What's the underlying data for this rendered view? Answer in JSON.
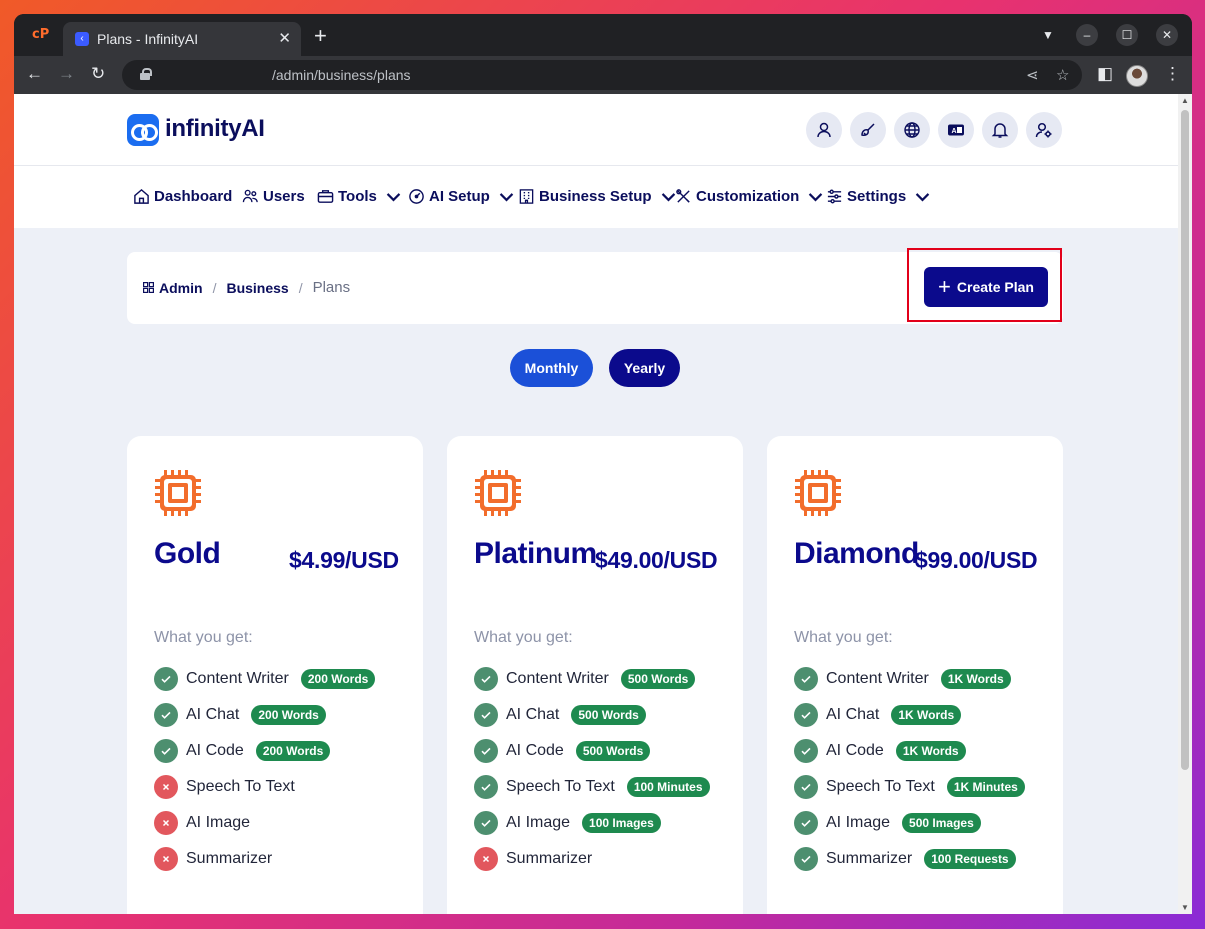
{
  "browser": {
    "tab_title": "Plans - InfinityAI",
    "url": "/admin/business/plans",
    "new_tab": "+",
    "tab_close": "✕"
  },
  "brand": {
    "name": "infinityAI"
  },
  "nav": {
    "items": [
      {
        "label": "Dashboard",
        "icon": "home-icon"
      },
      {
        "label": "Users",
        "icon": "users-icon"
      },
      {
        "label": "Tools",
        "icon": "briefcase-icon"
      },
      {
        "label": "AI Setup",
        "icon": "gauge-icon"
      },
      {
        "label": "Business Setup",
        "icon": "building-icon"
      },
      {
        "label": "Customization",
        "icon": "tools-icon"
      },
      {
        "label": "Settings",
        "icon": "sliders-icon"
      }
    ]
  },
  "breadcrumb": {
    "admin": "Admin",
    "business": "Business",
    "current": "Plans",
    "sep": "/"
  },
  "create_button": {
    "label": "Create Plan"
  },
  "billing_toggle": {
    "monthly": "Monthly",
    "yearly": "Yearly"
  },
  "colors": {
    "primary": "#0b0a8c",
    "accent": "#1b50d8",
    "success": "#1e8a4f",
    "check": "#4d8f6f",
    "cross": "#e2575d",
    "chip": "#f26d2c",
    "highlight": "#e2001a"
  },
  "plans": [
    {
      "name": "Gold",
      "price": "$4.99/USD",
      "features_heading": "What you get:",
      "features": [
        {
          "label": "Content Writer",
          "included": true,
          "badge": "200 Words"
        },
        {
          "label": "AI Chat",
          "included": true,
          "badge": "200 Words"
        },
        {
          "label": "AI Code",
          "included": true,
          "badge": "200 Words"
        },
        {
          "label": "Speech To Text",
          "included": false,
          "badge": ""
        },
        {
          "label": "AI Image",
          "included": false,
          "badge": ""
        },
        {
          "label": "Summarizer",
          "included": false,
          "badge": ""
        }
      ]
    },
    {
      "name": "Platinum",
      "price": "$49.00/USD",
      "features_heading": "What you get:",
      "features": [
        {
          "label": "Content Writer",
          "included": true,
          "badge": "500 Words"
        },
        {
          "label": "AI Chat",
          "included": true,
          "badge": "500 Words"
        },
        {
          "label": "AI Code",
          "included": true,
          "badge": "500 Words"
        },
        {
          "label": "Speech To Text",
          "included": true,
          "badge": "100 Minutes"
        },
        {
          "label": "AI Image",
          "included": true,
          "badge": "100 Images"
        },
        {
          "label": "Summarizer",
          "included": false,
          "badge": ""
        }
      ]
    },
    {
      "name": "Diamond",
      "price": "$99.00/USD",
      "features_heading": "What you get:",
      "features": [
        {
          "label": "Content Writer",
          "included": true,
          "badge": "1K Words"
        },
        {
          "label": "AI Chat",
          "included": true,
          "badge": "1K Words"
        },
        {
          "label": "AI Code",
          "included": true,
          "badge": "1K Words"
        },
        {
          "label": "Speech To Text",
          "included": true,
          "badge": "1K Minutes"
        },
        {
          "label": "AI Image",
          "included": true,
          "badge": "500 Images"
        },
        {
          "label": "Summarizer",
          "included": true,
          "badge": "100 Requests"
        }
      ]
    }
  ]
}
